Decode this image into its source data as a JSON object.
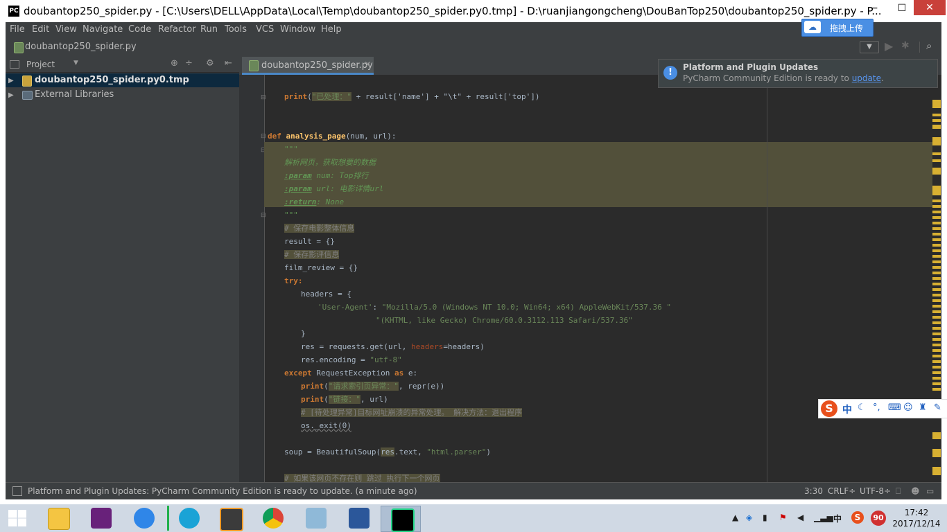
{
  "window": {
    "title": "doubantop250_spider.py - [C:\\Users\\DELL\\AppData\\Local\\Temp\\doubantop250_spider.py0.tmp] - D:\\ruanjiangongcheng\\DouBanTop250\\doubantop250_spider.py - P...",
    "app_icon_text": "PC",
    "minimize": "−",
    "maximize": "☐",
    "close": "✕"
  },
  "baidu": {
    "label": "拖拽上传"
  },
  "menu": [
    "File",
    "Edit",
    "View",
    "Navigate",
    "Code",
    "Refactor",
    "Run",
    "Tools",
    "VCS",
    "Window",
    "Help"
  ],
  "navbar": {
    "file": "doubantop250_spider.py"
  },
  "project": {
    "title": "Project",
    "items": [
      {
        "label": "doubantop250_spider.py0.tmp"
      },
      {
        "label": "External Libraries"
      }
    ]
  },
  "editor_tab": {
    "label": "doubantop250_spider.py",
    "close": "×"
  },
  "notification": {
    "title": "Platform and Plugin Updates",
    "body_prefix": "PyCharm Community Edition is ready to ",
    "link": "update",
    "body_suffix": "."
  },
  "code": {
    "l01": {
      "a": "print",
      "b": "(",
      "c": "\"已处理：\"",
      "d": " + result['name'] + \"\\t\" + result['top'])"
    },
    "l02": {
      "a": "def ",
      "b": "analysis_page",
      "c": "(num, url):"
    },
    "l03": "\"\"\"",
    "l04": "解析网页，获取想要的数据",
    "l05": {
      "a": ":param",
      "b": " num: Top排行"
    },
    "l06": {
      "a": ":param",
      "b": " url: 电影详情url"
    },
    "l07": {
      "a": ":return",
      "b": ": None"
    },
    "l08": "\"\"\"",
    "l09": "# 保存电影整体信息",
    "l10": "result = {}",
    "l11": "# 保存影评信息",
    "l12": "film_review = {}",
    "l13": "try:",
    "l14": "headers = {",
    "l15": {
      "a": "'User-Agent'",
      "b": ": ",
      "c": "\"Mozilla/5.0 (Windows NT 10.0; Win64; x64) AppleWebKit/537.36 \""
    },
    "l16": "\"(KHTML, like Gecko) Chrome/60.0.3112.113 Safari/537.36\"",
    "l17": "}",
    "l18": {
      "a": "res = requests.get(url, ",
      "b": "headers",
      "c": "=headers)"
    },
    "l19": {
      "a": "res.encoding = ",
      "b": "\"utf-8\""
    },
    "l20": {
      "a": "except ",
      "b": "RequestException ",
      "c": "as ",
      "d": "e:"
    },
    "l21": {
      "a": "print",
      "b": "(",
      "c": "\"请求索引页异常：\"",
      "d": ", repr(e))"
    },
    "l22": {
      "a": "print",
      "b": "(",
      "c": "\"链接：\"",
      "d": ", url)"
    },
    "l23": "# [待处理异常]目标网址崩溃的异常处理。 解决方法：退出程序",
    "l24": "os._exit(0)",
    "l25": {
      "a": "soup = BeautifulSoup(",
      "b": "res",
      "c": ".text, ",
      "d": "\"html.parser\"",
      "e": ")"
    },
    "l26": "# 如果该网页不存在则 跳过 执行下一个网页"
  },
  "statusbar": {
    "message": "Platform and Plugin Updates: PyCharm Community Edition is ready to update. (a minute ago)",
    "position": "3:30",
    "line_sep": "CRLF÷",
    "encoding": "UTF-8÷"
  },
  "ime": {
    "logo": "S",
    "mode": "中"
  },
  "taskbar": {
    "apps": [
      {
        "icon": "windows-start-icon",
        "color": "#1e88e5"
      },
      {
        "icon": "file-explorer-icon",
        "color": "#f4c542"
      },
      {
        "icon": "visual-studio-icon",
        "color": "#68217a"
      },
      {
        "icon": "baidu-netdisk-icon",
        "color": "#2f86e8"
      },
      {
        "icon": "media-player-icon",
        "color": "#1aa3d6"
      },
      {
        "icon": "sublime-text-icon",
        "color": "#3b3b3b"
      },
      {
        "icon": "chrome-icon",
        "color": "#db4437"
      },
      {
        "icon": "notes-icon",
        "color": "#8fb9d8"
      },
      {
        "icon": "word-icon",
        "color": "#2b579a"
      },
      {
        "icon": "pycharm-icon",
        "color": "#21d789"
      }
    ],
    "tray_ime": "中",
    "tray_badge": "90",
    "time": "17:42",
    "date": "2017/12/14"
  }
}
